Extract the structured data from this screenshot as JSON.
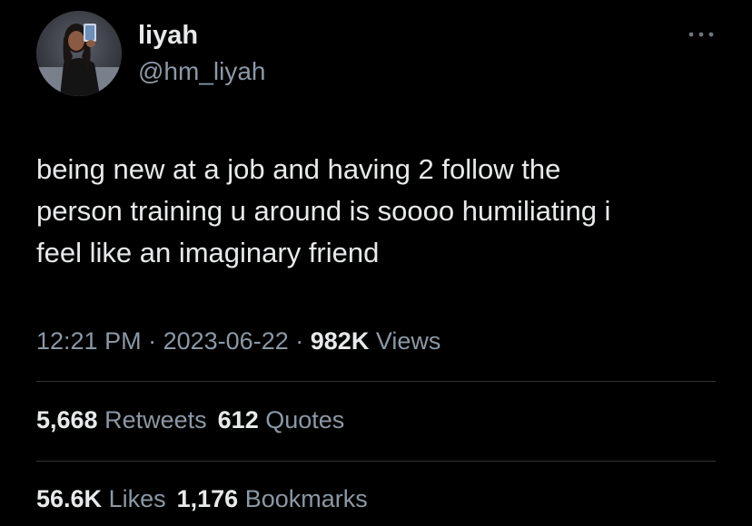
{
  "author": {
    "display_name": "liyah",
    "handle": "@hm_liyah"
  },
  "tweet": {
    "text": "being new at a job and having 2 follow the\nperson training u around is soooo humiliating i\nfeel like an imaginary friend",
    "time": "12:21 PM",
    "separator": "·",
    "date": "2023-06-22",
    "views_count": "982K",
    "views_label": "Views"
  },
  "stats": {
    "retweets_count": "5,668",
    "retweets_label": "Retweets",
    "quotes_count": "612",
    "quotes_label": "Quotes",
    "likes_count": "56.6K",
    "likes_label": "Likes",
    "bookmarks_count": "1,176",
    "bookmarks_label": "Bookmarks"
  },
  "icons": {
    "more": "more-horizontal-icon"
  },
  "colors": {
    "background": "#000000",
    "primary_text": "#e7e9ea",
    "secondary_text": "#8b98a5",
    "divider": "#2f3336"
  }
}
